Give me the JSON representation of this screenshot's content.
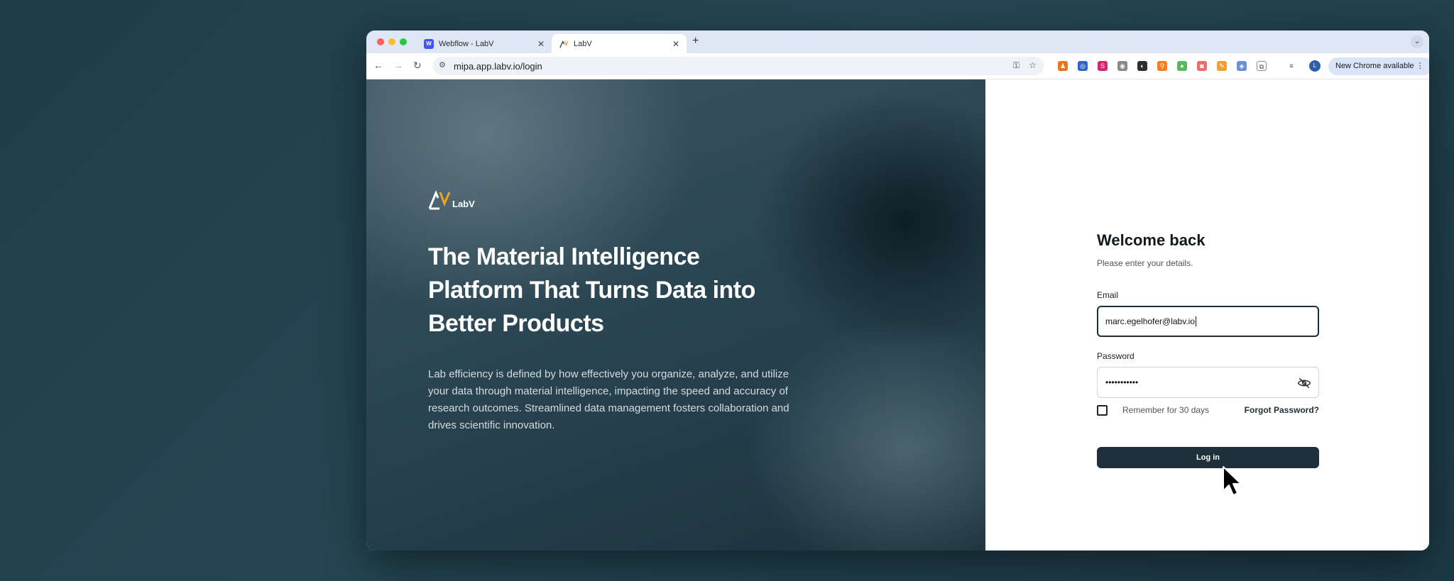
{
  "browser": {
    "tabs": [
      {
        "title": "Webflow - LabV",
        "favicon": "webflow-icon",
        "active": false
      },
      {
        "title": "LabV",
        "favicon": "labv-icon",
        "active": true
      }
    ],
    "new_tab": "+",
    "url": "mipa.app.labv.io/login",
    "update_button": "New Chrome available",
    "profile_initial": "L",
    "favicon_badge": "W"
  },
  "hero": {
    "logo_text": "LabV",
    "headline": "The Material Intelligence Platform That Turns Data into Better Products",
    "paragraph": "Lab efficiency is defined by how effectively you organize, analyze, and utilize your data through material intelligence, impacting the speed and accuracy of research outcomes. Streamlined data management fosters collaboration and drives scientific innovation."
  },
  "login": {
    "title": "Welcome back",
    "subtitle": "Please enter your details.",
    "email_label": "Email",
    "email_value": "marc.egelhofer@labv.io",
    "password_label": "Password",
    "password_value": "•••••••••••",
    "remember_label": "Remember for 30 days",
    "forgot_label": "Forgot Password?",
    "login_button": "Log in"
  },
  "colors": {
    "accent": "#1e3039",
    "logo_orange": "#f5a31a"
  }
}
